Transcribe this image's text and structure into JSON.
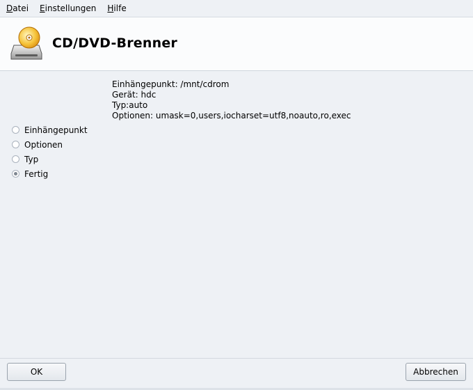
{
  "menubar": {
    "items": [
      {
        "accel": "D",
        "rest": "atei"
      },
      {
        "accel": "E",
        "rest": "instellungen"
      },
      {
        "accel": "H",
        "rest": "ilfe"
      }
    ]
  },
  "header": {
    "title": "CD/DVD-Brenner",
    "icon": "cdrom-drive-icon"
  },
  "info": {
    "mountpoint": "Einhängepunkt: /mnt/cdrom",
    "device": "Gerät: hdc",
    "type": "Typ:auto",
    "options": "Optionen: umask=0,users,iocharset=utf8,noauto,ro,exec"
  },
  "radio_options": {
    "items": [
      {
        "label": "Einhängepunkt",
        "checked": false
      },
      {
        "label": "Optionen",
        "checked": false
      },
      {
        "label": "Typ",
        "checked": false
      },
      {
        "label": "Fertig",
        "checked": true
      }
    ]
  },
  "buttons": {
    "ok": "OK",
    "cancel": "Abbrechen"
  }
}
